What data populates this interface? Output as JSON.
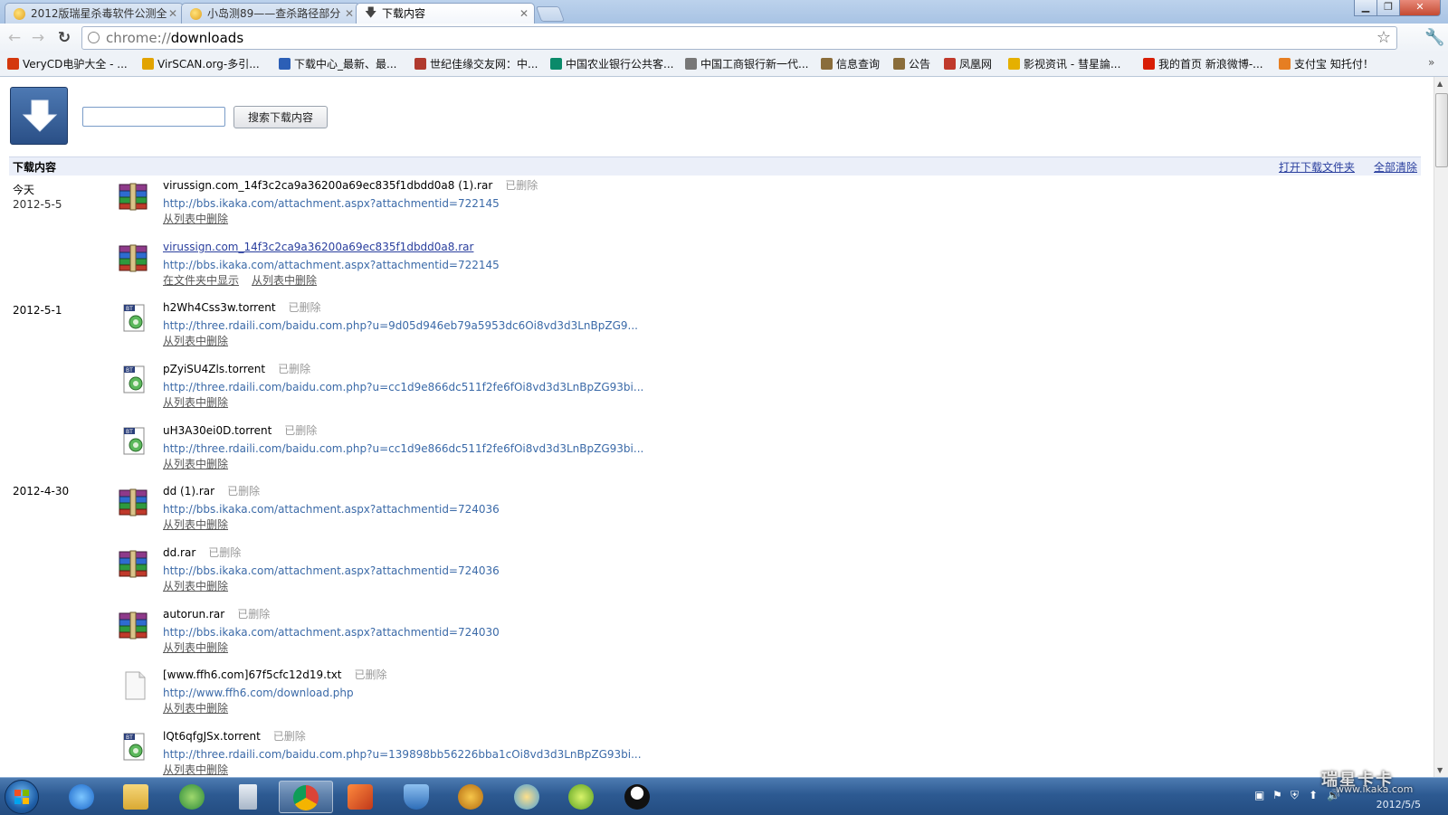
{
  "tabs": [
    {
      "title": "2012版瑞星杀毒软件公测全"
    },
    {
      "title": "小岛测89——查杀路径部分"
    },
    {
      "title": "下载内容"
    }
  ],
  "toolbar": {
    "url_scheme": "chrome://",
    "url_path": "downloads"
  },
  "bookmarks": [
    {
      "label": "VeryCD电驴大全 - ...",
      "color": "#d4380d"
    },
    {
      "label": "VirSCAN.org-多引...",
      "color": "#e2a300"
    },
    {
      "label": "下载中心_最新、最...",
      "color": "#2c5fb6"
    },
    {
      "label": "世纪佳缘交友网：中...",
      "color": "#b03a2e"
    },
    {
      "label": "中国农业银行公共客...",
      "color": "#0a8a6a"
    },
    {
      "label": "中国工商银行新一代...",
      "color": "#777777"
    },
    {
      "label": "信息查询",
      "color": "#8a6d3b"
    },
    {
      "label": "公告",
      "color": "#8a6d3b"
    },
    {
      "label": "凤凰网",
      "color": "#c0392b"
    },
    {
      "label": "影视资讯 - 彗星論...",
      "color": "#e5b000"
    },
    {
      "label": "我的首页 新浪微博-...",
      "color": "#d81e06"
    },
    {
      "label": "支付宝 知托付！",
      "color": "#e67e22"
    }
  ],
  "downloads_page": {
    "search_placeholder": "",
    "search_button": "搜索下载内容",
    "section_title": "下载内容",
    "open_folder": "打开下载文件夹",
    "clear_all": "全部清除"
  },
  "dates": [
    {
      "line1": "今天",
      "line2": "2012-5-5"
    },
    {
      "line1": "2012-5-1",
      "line2": ""
    },
    {
      "line1": "2012-4-30",
      "line2": ""
    }
  ],
  "items": [
    {
      "name": "virussign.com_14f3c2ca9a36200a69ec835f1dbdd0a8 (1).rar",
      "status": "已删除",
      "url": "http://bbs.ikaka.com/attachment.aspx?attachmentid=722145",
      "actions": [
        "从列表中删除"
      ],
      "icon": "rar-icon"
    },
    {
      "name": "virussign.com_14f3c2ca9a36200a69ec835f1dbdd0a8.rar",
      "status": "",
      "url": "http://bbs.ikaka.com/attachment.aspx?attachmentid=722145",
      "actions": [
        "在文件夹中显示",
        "从列表中删除"
      ],
      "icon": "rar-icon"
    },
    {
      "name": "h2Wh4Css3w.torrent",
      "status": "已删除",
      "url": "http://three.rdaili.com/baidu.com.php?u=9d05d946eb79a5953dc6Oi8vd3d3LnBpZG9...",
      "actions": [
        "从列表中删除"
      ],
      "icon": "torrent-icon"
    },
    {
      "name": "pZyiSU4Zls.torrent",
      "status": "已删除",
      "url": "http://three.rdaili.com/baidu.com.php?u=cc1d9e866dc511f2fe6fOi8vd3d3LnBpZG93bi...",
      "actions": [
        "从列表中删除"
      ],
      "icon": "torrent-icon"
    },
    {
      "name": "uH3A30ei0D.torrent",
      "status": "已删除",
      "url": "http://three.rdaili.com/baidu.com.php?u=cc1d9e866dc511f2fe6fOi8vd3d3LnBpZG93bi...",
      "actions": [
        "从列表中删除"
      ],
      "icon": "torrent-icon"
    },
    {
      "name": "dd (1).rar",
      "status": "已删除",
      "url": "http://bbs.ikaka.com/attachment.aspx?attachmentid=724036",
      "actions": [
        "从列表中删除"
      ],
      "icon": "rar-icon"
    },
    {
      "name": "dd.rar",
      "status": "已删除",
      "url": "http://bbs.ikaka.com/attachment.aspx?attachmentid=724036",
      "actions": [
        "从列表中删除"
      ],
      "icon": "rar-icon"
    },
    {
      "name": "autorun.rar",
      "status": "已删除",
      "url": "http://bbs.ikaka.com/attachment.aspx?attachmentid=724030",
      "actions": [
        "从列表中删除"
      ],
      "icon": "rar-icon"
    },
    {
      "name": "[www.ffh6.com]67f5cfc12d19.txt",
      "status": "已删除",
      "url": "http://www.ffh6.com/download.php",
      "actions": [
        "从列表中删除"
      ],
      "icon": "txt-icon"
    },
    {
      "name": "lQt6qfgJSx.torrent",
      "status": "已删除",
      "url": "http://three.rdaili.com/baidu.com.php?u=139898bb56226bba1cOi8vd3d3LnBpZG93bi...",
      "actions": [
        "从列表中删除"
      ],
      "icon": "torrent-icon"
    }
  ],
  "ime_bar": [
    "中",
    "☽",
    "°,",
    "⌨",
    "👤",
    "👕",
    "🔧"
  ],
  "taskbar": {
    "apps": [
      "ie-icon",
      "explorer-icon",
      "network-icon",
      "calculator-icon",
      "chrome-icon",
      "app-icon",
      "firewall-icon",
      "rising-icon",
      "rising-monitor-icon",
      "download-icon",
      "qq-icon"
    ],
    "date": "2012/5/5"
  },
  "watermark": {
    "brand": "瑞星卡卡",
    "site": "www.ikaka.com"
  }
}
